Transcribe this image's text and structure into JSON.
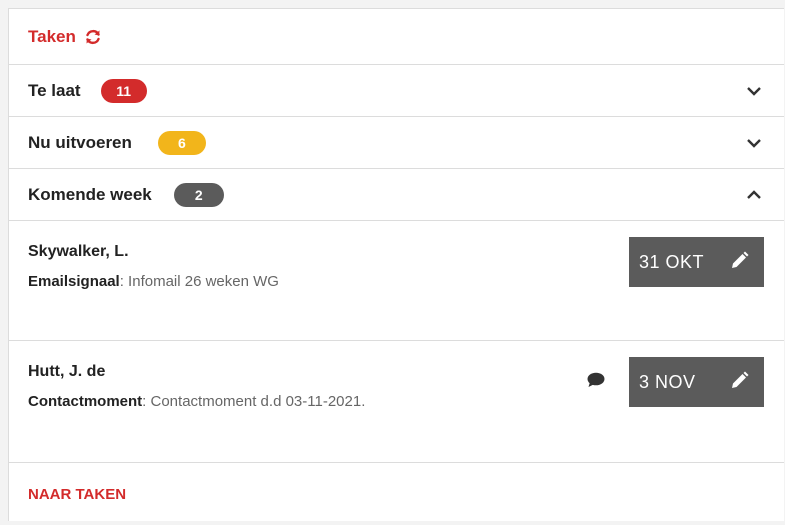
{
  "header": {
    "title": "Taken",
    "icon": "refresh-icon"
  },
  "colors": {
    "accent": "#d32b2b",
    "late": "#d32b2b",
    "now": "#f2b51b",
    "week": "#5b5b5b"
  },
  "sections": [
    {
      "label": "Te laat",
      "count": "11",
      "state": "collapsed"
    },
    {
      "label": "Nu uitvoeren",
      "count": "6",
      "state": "collapsed"
    },
    {
      "label": "Komende week",
      "count": "2",
      "state": "expanded"
    }
  ],
  "tasks": [
    {
      "name": "Skywalker, L.",
      "type": "Emailsignaal",
      "description": ": Infomail 26 weken WG",
      "date": "31 OKT",
      "has_comment": false
    },
    {
      "name": "Hutt, J. de",
      "type": "Contactmoment",
      "description": ": Contactmoment d.d 03-11-2021.",
      "date": "3 NOV",
      "has_comment": true
    }
  ],
  "footer": {
    "link": "NAAR TAKEN"
  }
}
